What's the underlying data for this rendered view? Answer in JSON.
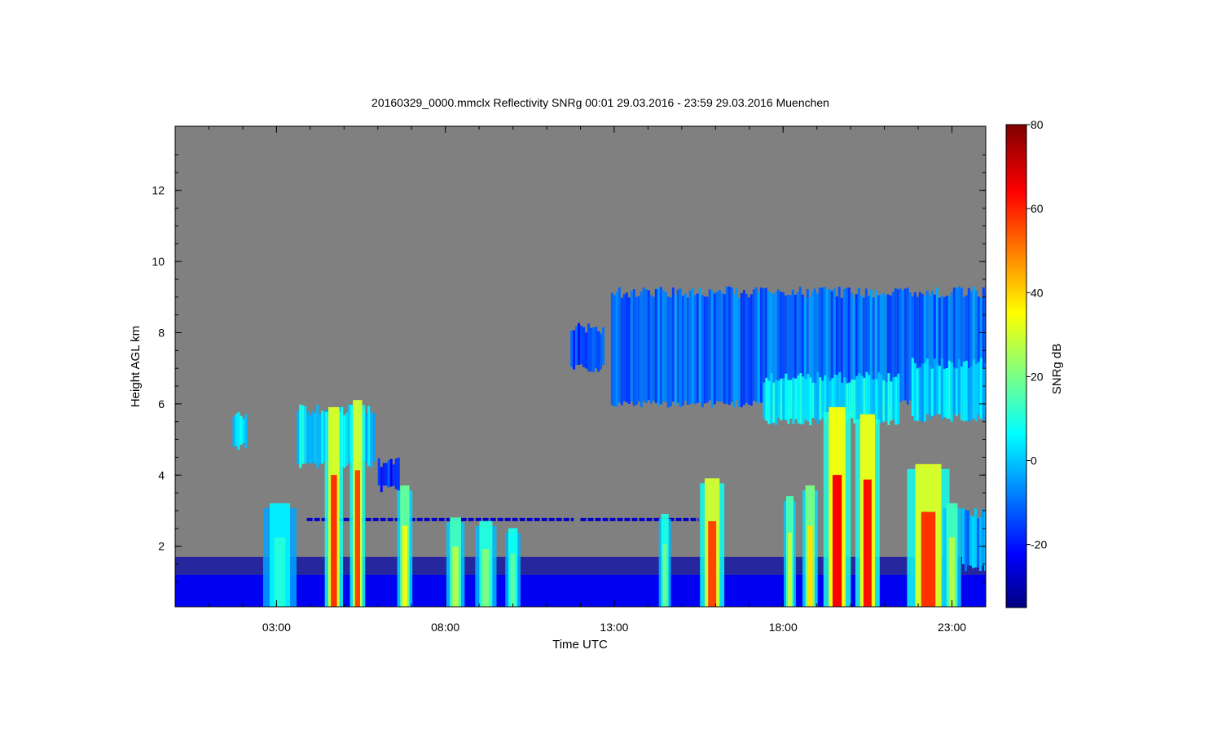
{
  "chart_data": {
    "type": "heatmap",
    "title": "20160329_0000.mmclx Reflectivity SNRg   00:01 29.03.2016 - 23:59 29.03.2016 Muenchen",
    "xlabel": "Time UTC",
    "ylabel": "Height AGL km",
    "colorbar_label": "SNRg dB",
    "x_tick_labels": [
      "03:00",
      "08:00",
      "13:00",
      "18:00",
      "23:00"
    ],
    "x_ticks_hours": [
      3,
      8,
      13,
      18,
      23
    ],
    "xlim_hours": [
      0,
      24
    ],
    "y_tick_labels": [
      "2",
      "4",
      "6",
      "8",
      "10",
      "12"
    ],
    "y_ticks_km": [
      2,
      4,
      6,
      8,
      10,
      12
    ],
    "ylim_km": [
      0.3,
      13.8
    ],
    "colorbar_tick_labels": [
      "-20",
      "0",
      "20",
      "40",
      "60",
      "80"
    ],
    "colorbar_ticks_db": [
      -20,
      0,
      20,
      40,
      60,
      80
    ],
    "colorbar_range_db": [
      -35,
      80
    ],
    "background_color": "#808080",
    "colormap": [
      "#00007f",
      "#0000ff",
      "#007fff",
      "#00ffff",
      "#7fff7f",
      "#ffff00",
      "#ff7f00",
      "#ff0000",
      "#7f0000"
    ],
    "features": [
      {
        "kind": "ground_clutter_band",
        "t_start": 0.0,
        "t_end": 24.0,
        "h_bottom": 0.3,
        "h_top": 1.2,
        "snr_db": -22
      },
      {
        "kind": "dotted_layer",
        "t_start": 3.9,
        "t_end": 11.8,
        "h": 2.75,
        "snr_db": -27
      },
      {
        "kind": "dotted_layer",
        "t_start": 12.0,
        "t_end": 15.5,
        "h": 2.75,
        "snr_db": -27
      },
      {
        "kind": "cloud_patch",
        "t_start": 1.7,
        "t_end": 2.1,
        "h_bottom": 4.8,
        "h_top": 5.7,
        "snr_db": 5
      },
      {
        "kind": "cloud_patch",
        "t_start": 3.6,
        "t_end": 5.9,
        "h_bottom": 4.3,
        "h_top": 5.9,
        "snr_db": 4
      },
      {
        "kind": "cloud_patch",
        "t_start": 6.0,
        "t_end": 6.6,
        "h_bottom": 3.6,
        "h_top": 4.4,
        "snr_db": -14
      },
      {
        "kind": "cloud_patch",
        "t_start": 11.7,
        "t_end": 12.7,
        "h_bottom": 7.0,
        "h_top": 8.2,
        "snr_db": -14
      },
      {
        "kind": "cloud_patch",
        "t_start": 12.9,
        "t_end": 24.0,
        "h_bottom": 6.0,
        "h_top": 9.2,
        "snr_db": -8
      },
      {
        "kind": "cloud_patch",
        "t_start": 17.4,
        "t_end": 21.4,
        "h_bottom": 5.5,
        "h_top": 6.8,
        "snr_db": 6
      },
      {
        "kind": "cloud_patch",
        "t_start": 21.8,
        "t_end": 24.0,
        "h_bottom": 5.6,
        "h_top": 7.2,
        "snr_db": 3
      },
      {
        "kind": "cloud_patch",
        "t_start": 23.3,
        "t_end": 24.0,
        "h_bottom": 1.4,
        "h_top": 3.0,
        "snr_db": -3
      },
      {
        "kind": "precip_column",
        "t": 3.1,
        "width_h": 0.55,
        "h_top": 3.3,
        "snr_db": 12
      },
      {
        "kind": "precip_column",
        "t": 4.7,
        "width_h": 0.3,
        "h_top": 6.0,
        "snr_db": 60
      },
      {
        "kind": "precip_column",
        "t": 5.4,
        "width_h": 0.25,
        "h_top": 6.2,
        "snr_db": 58
      },
      {
        "kind": "precip_column",
        "t": 6.8,
        "width_h": 0.25,
        "h_top": 3.8,
        "snr_db": 35
      },
      {
        "kind": "precip_column",
        "t": 8.3,
        "width_h": 0.3,
        "h_top": 2.9,
        "snr_db": 28
      },
      {
        "kind": "precip_column",
        "t": 9.2,
        "width_h": 0.35,
        "h_top": 2.8,
        "snr_db": 22
      },
      {
        "kind": "precip_column",
        "t": 10.0,
        "width_h": 0.25,
        "h_top": 2.6,
        "snr_db": 18
      },
      {
        "kind": "precip_column",
        "t": 14.5,
        "width_h": 0.2,
        "h_top": 3.0,
        "snr_db": 20
      },
      {
        "kind": "precip_column",
        "t": 15.9,
        "width_h": 0.4,
        "h_top": 4.0,
        "snr_db": 58
      },
      {
        "kind": "precip_column",
        "t": 18.2,
        "width_h": 0.2,
        "h_top": 3.5,
        "snr_db": 30
      },
      {
        "kind": "precip_column",
        "t": 18.8,
        "width_h": 0.25,
        "h_top": 3.8,
        "snr_db": 40
      },
      {
        "kind": "precip_column",
        "t": 19.6,
        "width_h": 0.45,
        "h_top": 6.0,
        "snr_db": 66
      },
      {
        "kind": "precip_column",
        "t": 20.5,
        "width_h": 0.4,
        "h_top": 5.8,
        "snr_db": 64
      },
      {
        "kind": "precip_column",
        "t": 22.3,
        "width_h": 0.7,
        "h_top": 4.4,
        "snr_db": 60
      },
      {
        "kind": "precip_column",
        "t": 23.0,
        "width_h": 0.3,
        "h_top": 3.3,
        "snr_db": 28
      }
    ],
    "grid": false,
    "legend": "colorbar-right"
  }
}
